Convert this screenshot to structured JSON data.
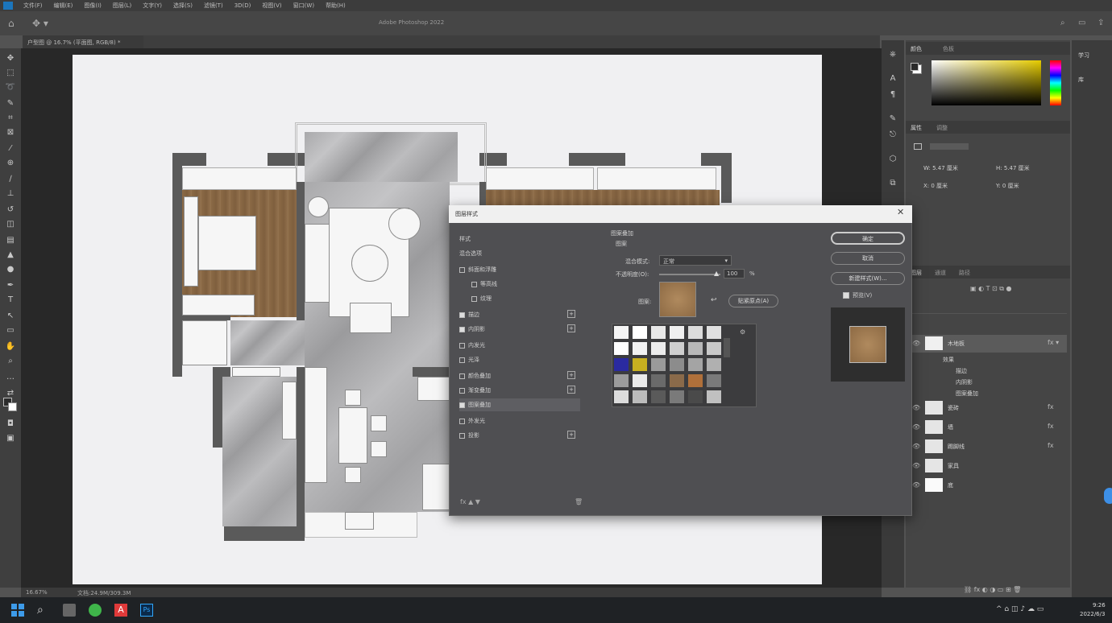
{
  "app": {
    "name": "Adobe Photoshop",
    "accent": "#1b75bc"
  },
  "menubar": {
    "items": [
      "文件(F)",
      "编辑(E)",
      "图像(I)",
      "图层(L)",
      "文字(Y)",
      "选择(S)",
      "滤镜(T)",
      "3D(D)",
      "视图(V)",
      "窗口(W)",
      "帮助(H)"
    ]
  },
  "optbar": {
    "window_title": "Adobe Photoshop 2022"
  },
  "document": {
    "tab_label": "户型图 @ 16.7% (平面图, RGB/8) *",
    "zoom": "16.67%",
    "doc_info": "文档:24.9M/309.3M"
  },
  "dialog": {
    "title": "图层样式",
    "left_items": [
      {
        "label": "样式",
        "checkbox": false,
        "checked": false,
        "plus": false
      },
      {
        "label": "混合选项",
        "checkbox": false,
        "checked": false,
        "plus": false
      },
      {
        "label": "斜面和浮雕",
        "checkbox": true,
        "checked": false,
        "plus": false
      },
      {
        "label": "等高线",
        "checkbox": true,
        "checked": false,
        "plus": false
      },
      {
        "label": "纹理",
        "checkbox": true,
        "checked": false,
        "plus": false
      },
      {
        "label": "描边",
        "checkbox": true,
        "checked": true,
        "plus": true
      },
      {
        "label": "内阴影",
        "checkbox": true,
        "checked": true,
        "plus": true
      },
      {
        "label": "内发光",
        "checkbox": true,
        "checked": false,
        "plus": false
      },
      {
        "label": "光泽",
        "checkbox": true,
        "checked": false,
        "plus": false
      },
      {
        "label": "颜色叠加",
        "checkbox": true,
        "checked": false,
        "plus": true
      },
      {
        "label": "渐变叠加",
        "checkbox": true,
        "checked": false,
        "plus": true
      },
      {
        "label": "图案叠加",
        "checkbox": true,
        "checked": true,
        "plus": false,
        "selected": true
      },
      {
        "label": "外发光",
        "checkbox": true,
        "checked": false,
        "plus": false
      },
      {
        "label": "投影",
        "checkbox": true,
        "checked": false,
        "plus": true
      }
    ],
    "section_title": "图案叠加",
    "section_sub": "图案",
    "blend_mode_label": "混合模式:",
    "blend_mode_value": "正常",
    "opacity_label": "不透明度(O):",
    "opacity_value": "100",
    "opacity_unit": "%",
    "pattern_label": "图案:",
    "snap_button": "贴紧原点(A)",
    "buttons": {
      "ok": "确定",
      "cancel": "取消",
      "new_style": "新建样式(W)...",
      "preview": "预览(V)"
    },
    "preview_checked": true
  },
  "panels": {
    "color_tabs": [
      "颜色",
      "色板"
    ],
    "props_tabs": [
      "属性",
      "调整"
    ],
    "props_labels": [
      "W: 5.47 厘米",
      "H: 5.47 厘米",
      "X: 0 厘米",
      "Y: 0 厘米"
    ],
    "layers_tabs": [
      "图层",
      "通道",
      "路径"
    ],
    "layers": [
      {
        "name": "木地板",
        "fx": true,
        "expanded": true
      },
      {
        "name": "瓷砖",
        "fx": true
      },
      {
        "name": "墙",
        "fx": true
      },
      {
        "name": "踢脚线",
        "fx": true
      },
      {
        "name": "家具",
        "fx": false
      },
      {
        "name": "底",
        "fx": false
      }
    ],
    "sublayers": [
      "效果",
      "描边",
      "内阴影",
      "图案叠加"
    ],
    "far_right": [
      "学习",
      "库"
    ]
  },
  "taskbar": {
    "time": "9:26",
    "date": "2022/6/3"
  }
}
